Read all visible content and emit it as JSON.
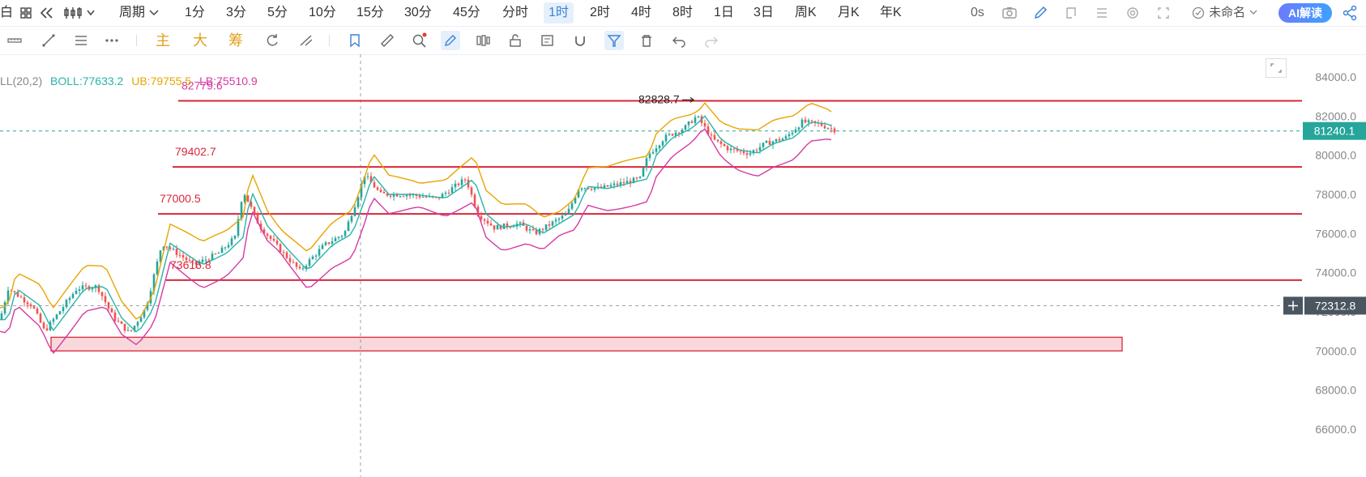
{
  "topbar": {
    "left_label": "白",
    "period_label": "周期",
    "timeframes": [
      "1分",
      "3分",
      "5分",
      "10分",
      "15分",
      "30分",
      "45分",
      "分时",
      "1时",
      "2时",
      "4时",
      "8时",
      "1日",
      "3日",
      "周K",
      "月K",
      "年K"
    ],
    "active_timeframe": "1时",
    "countdown": "0s",
    "layout_name": "未命名",
    "ai_label": "AI解读"
  },
  "toolbar": {
    "indicator_chars": [
      "主",
      "大",
      "筹"
    ]
  },
  "legend": {
    "name": "LL(20,2)",
    "boll": "BOLL:77633.2",
    "ub": "UB:79755.5",
    "lb": "LB:75510.9"
  },
  "colors": {
    "red_line": "#d9263a",
    "boll_mid": "#2ab3a6",
    "boll_ub": "#e8a400",
    "boll_lb": "#d63aa4",
    "up": "#26a69a",
    "down": "#ef5350",
    "current_price_tag": "#26a69a",
    "crosshair_tag": "#4a5560"
  },
  "chart_data": {
    "type": "candlestick",
    "y_ticks": [
      84000,
      82000,
      80000,
      78000,
      76000,
      74000,
      72000,
      70000,
      68000,
      66000
    ],
    "y_tick_labels": [
      "84000.0",
      "82000.0",
      "80000.0",
      "78000.0",
      "76000.0",
      "74000.0",
      "72000.0",
      "70000.0",
      "68000.0",
      "66000.0"
    ],
    "ylim": [
      65500,
      85500
    ],
    "current_price": "81240.1",
    "crosshair_price": "72312.8",
    "annotations": [
      {
        "text": "82779.6",
        "value": 82779.6
      },
      {
        "text": "82828.7",
        "value": 82828.7
      },
      {
        "text": "79402.7",
        "value": 79402.7
      },
      {
        "text": "77000.5",
        "value": 77000.5
      },
      {
        "text": "73616.8",
        "value": 73616.8
      }
    ],
    "horizontal_lines": [
      82779.6,
      79402.7,
      77000.5,
      73616.8
    ],
    "zone": {
      "low": 70000,
      "high": 70700
    },
    "boll_shown": true
  }
}
